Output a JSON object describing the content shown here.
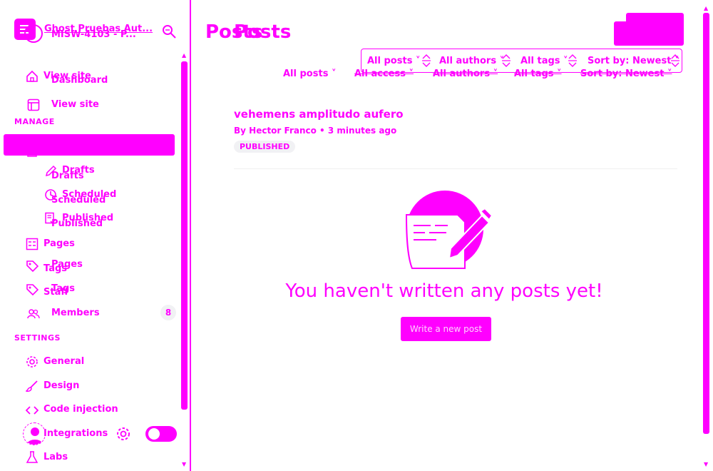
{
  "colors": {
    "accent": "#ff00ff",
    "background": "#ffffff"
  },
  "sidebar": {
    "site_title": "Ghost Pruebas Aut...",
    "site_subtitle": "MISW-4103 - P...",
    "view_site_ghost": "View site",
    "dashboard": "Dashboard",
    "view_site": "View site",
    "manage_label": "MANAGE",
    "posts_sub": [
      {
        "label": "Drafts",
        "ghost": "Drafts",
        "icon": "pencil-icon"
      },
      {
        "label": "Scheduled",
        "ghost": "Scheduled",
        "icon": "clock-icon"
      },
      {
        "label": "Published",
        "ghost": "Published",
        "icon": "document-check-icon"
      }
    ],
    "pages": "Pages",
    "pages_ghost": "Pages",
    "tags_ghost": "Tags",
    "tags": "Tags",
    "staff_ghost": "Staff",
    "members": "Members",
    "members_count": "8",
    "settings_label": "SETTINGS",
    "general": "General",
    "design": "Design",
    "code_injection": "Code injection",
    "integrations": "Integrations",
    "labs": "Labs"
  },
  "main": {
    "title_ghost": "Posts",
    "title": "Posts",
    "filters_top": [
      "All posts",
      "All authors",
      "All tags",
      "Sort by: Newest"
    ],
    "filters_bottom": [
      "All posts",
      "All access",
      "All authors",
      "All tags",
      "Sort by: Newest"
    ],
    "post": {
      "title": "vehemens amplitudo aufero",
      "byline": "By Hector Franco • 3 minutes ago",
      "status": "PUBLISHED"
    },
    "empty_message": "You haven't written any posts yet!",
    "write_button": "Write a new post"
  }
}
